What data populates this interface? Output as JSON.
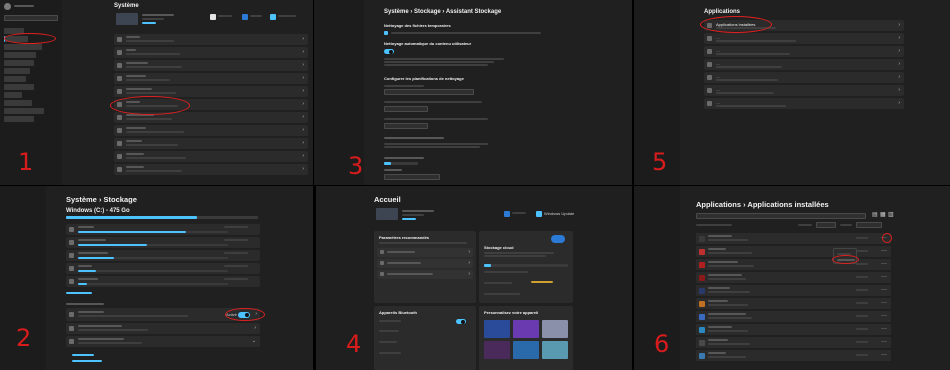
{
  "steps": [
    "1",
    "2",
    "3",
    "4",
    "5",
    "6"
  ],
  "accent": "#4cc2ff",
  "annotation_color": "#e02020",
  "panel1": {
    "title": "Système"
  },
  "panel2": {
    "breadcrumb_parent": "Système",
    "breadcrumb_current": "Stockage",
    "drive_title": "Windows (C:) - 475 Go",
    "toggle_label": "Activé"
  },
  "panel3": {
    "breadcrumb_parent": "Système",
    "breadcrumb_1": "Stockage",
    "breadcrumb_2": "Assistant Stockage",
    "section_1": "Nettoyage des fichiers temporaires",
    "section_2": "Nettoyage automatique du contenu utilisateur",
    "section_3": "Configurer les planifications de nettoyage"
  },
  "panel4": {
    "title": "Accueil",
    "card_recommended": "Paramètres recommandés",
    "card_cloud": "Stockage cloud",
    "card_bluetooth": "Appareils Bluetooth",
    "card_personalize": "Personnalisez votre appareil",
    "windows_update": "Windows Update"
  },
  "panel5": {
    "title": "Applications",
    "items": [
      "Applications installées",
      "…",
      "…",
      "…",
      "…",
      "…",
      "…"
    ]
  },
  "panel6": {
    "breadcrumb_parent": "Applications",
    "breadcrumb_current": "Applications installées"
  }
}
